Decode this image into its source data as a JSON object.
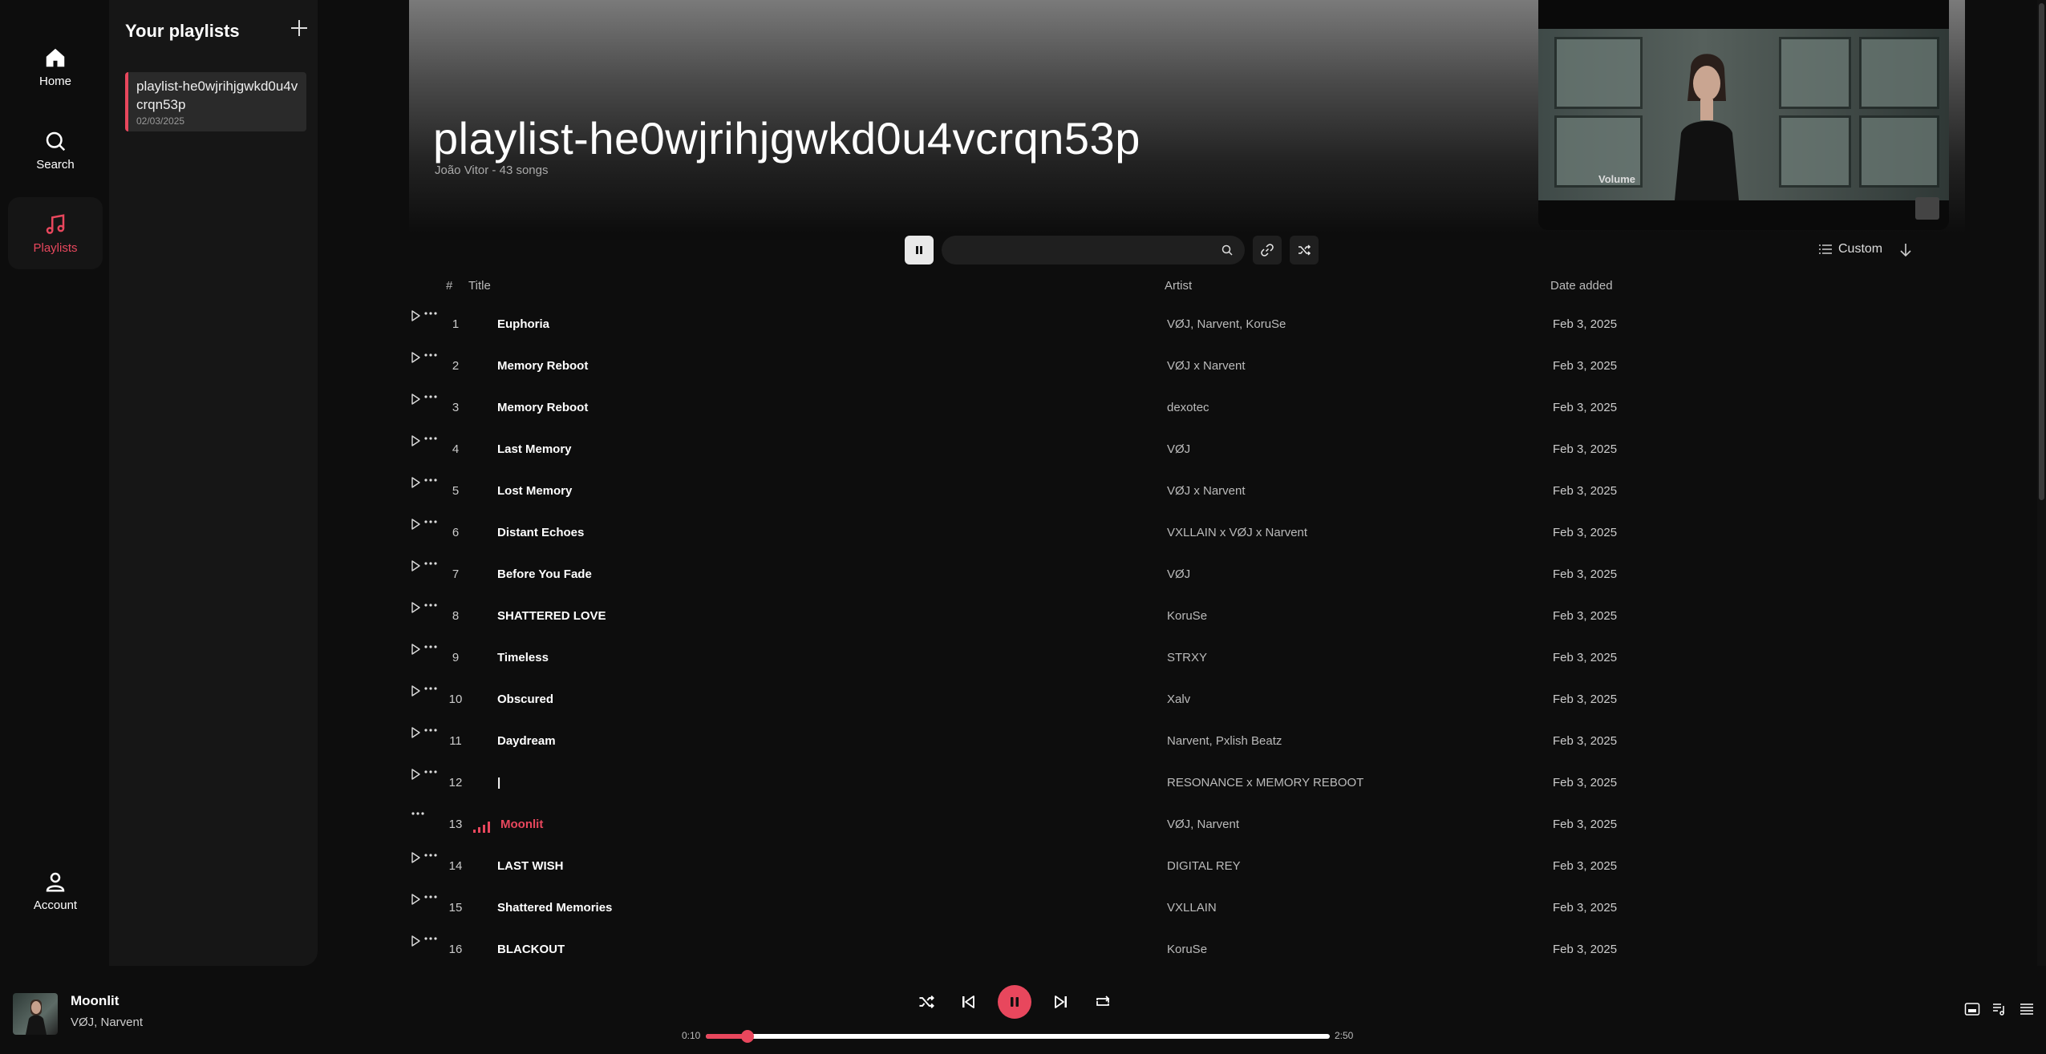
{
  "nav": {
    "home": "Home",
    "search": "Search",
    "playlists": "Playlists",
    "account": "Account"
  },
  "library": {
    "title": "Your playlists",
    "playlists": [
      {
        "name": "playlist-he0wjrihjgwkd0u4vcrqn53p",
        "date": "02/03/2025"
      }
    ]
  },
  "playlist": {
    "title": "playlist-he0wjrihjgwkd0u4vcrqn53p",
    "subtitle": "João Vitor - 43 songs"
  },
  "video": {
    "label": "Volume"
  },
  "toolbar": {
    "search_placeholder": "",
    "sort_label": "Custom"
  },
  "columns": {
    "number": "#",
    "title": "Title",
    "artist": "Artist",
    "date": "Date added"
  },
  "tracks": [
    {
      "n": "1",
      "title": "Euphoria",
      "artist": "VØJ, Narvent, KoruSe",
      "date": "Feb 3, 2025"
    },
    {
      "n": "2",
      "title": "Memory Reboot",
      "artist": "VØJ x Narvent",
      "date": "Feb 3, 2025"
    },
    {
      "n": "3",
      "title": "Memory Reboot",
      "artist": "dexotec",
      "date": "Feb 3, 2025"
    },
    {
      "n": "4",
      "title": "Last Memory",
      "artist": "VØJ",
      "date": "Feb 3, 2025"
    },
    {
      "n": "5",
      "title": "Lost Memory",
      "artist": "VØJ x Narvent",
      "date": "Feb 3, 2025"
    },
    {
      "n": "6",
      "title": "Distant Echoes",
      "artist": "VXLLAIN x VØJ x Narvent",
      "date": "Feb 3, 2025"
    },
    {
      "n": "7",
      "title": "Before You Fade",
      "artist": "VØJ",
      "date": "Feb 3, 2025"
    },
    {
      "n": "8",
      "title": "SHATTERED LOVE",
      "artist": "KoruSe",
      "date": "Feb 3, 2025"
    },
    {
      "n": "9",
      "title": "Timeless",
      "artist": "STRXY",
      "date": "Feb 3, 2025"
    },
    {
      "n": "10",
      "title": "Obscured",
      "artist": "Xalv",
      "date": "Feb 3, 2025"
    },
    {
      "n": "11",
      "title": "Daydream",
      "artist": "Narvent, Pxlish Beatz",
      "date": "Feb 3, 2025"
    },
    {
      "n": "12",
      "title": "|",
      "artist": "RESONANCE x MEMORY REBOOT",
      "date": "Feb 3, 2025"
    },
    {
      "n": "13",
      "title": "Moonlit",
      "artist": "VØJ, Narvent",
      "date": "Feb 3, 2025",
      "playing": true
    },
    {
      "n": "14",
      "title": "LAST WISH",
      "artist": "DIGITAL REY",
      "date": "Feb 3, 2025"
    },
    {
      "n": "15",
      "title": "Shattered Memories",
      "artist": "VXLLAIN",
      "date": "Feb 3, 2025"
    },
    {
      "n": "16",
      "title": "BLACKOUT",
      "artist": "KoruSe",
      "date": "Feb 3, 2025"
    }
  ],
  "player": {
    "track": "Moonlit",
    "artist": "VØJ, Narvent",
    "elapsed": "0:10",
    "duration": "2:50",
    "progress": 0.0667
  },
  "colors": {
    "accent": "#e8475d",
    "background": "#0d0d0d",
    "panel": "#161616"
  }
}
